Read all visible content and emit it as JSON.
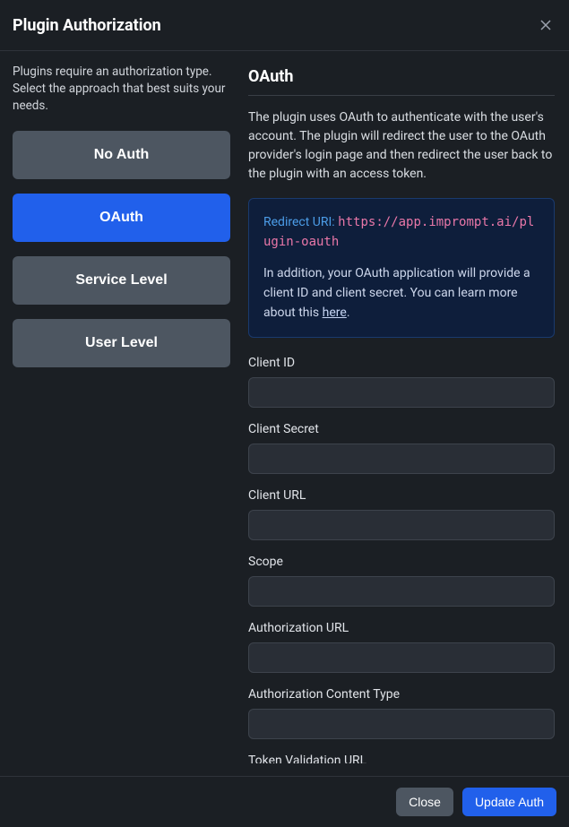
{
  "header": {
    "title": "Plugin Authorization"
  },
  "sidebar": {
    "intro": "Plugins require an authorization type. Select the approach that best suits your needs.",
    "tabs": [
      {
        "label": "No Auth",
        "active": false
      },
      {
        "label": "OAuth",
        "active": true
      },
      {
        "label": "Service Level",
        "active": false
      },
      {
        "label": "User Level",
        "active": false
      }
    ]
  },
  "content": {
    "title": "OAuth",
    "description": "The plugin uses OAuth to authenticate with the user's account. The plugin will redirect the user to the OAuth provider's login page and then redirect the user back to the plugin with an access token.",
    "info": {
      "redirect_label": "Redirect URI:",
      "redirect_uri": "https://app.imprompt.ai/plugin-oauth",
      "extra_text_before": "In addition, your OAuth application will provide a client ID and client secret. You can learn more about this ",
      "link_text": "here",
      "extra_text_after": "."
    },
    "fields": [
      {
        "label": "Client ID",
        "value": ""
      },
      {
        "label": "Client Secret",
        "value": ""
      },
      {
        "label": "Client URL",
        "value": ""
      },
      {
        "label": "Scope",
        "value": ""
      },
      {
        "label": "Authorization URL",
        "value": ""
      },
      {
        "label": "Authorization Content Type",
        "value": ""
      },
      {
        "label": "Token Validation URL",
        "value": ""
      }
    ]
  },
  "footer": {
    "close": "Close",
    "submit": "Update Auth"
  }
}
